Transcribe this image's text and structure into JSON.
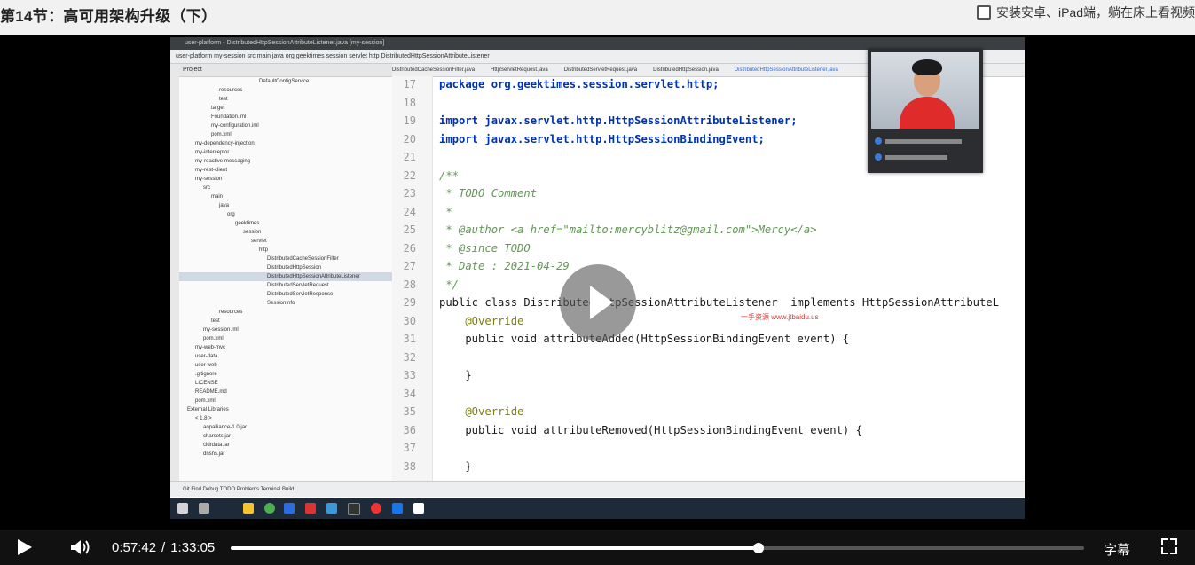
{
  "header": {
    "lesson_title": "第14节：高可用架构升级（下）",
    "install_promo": "安装安卓、iPad端，躺在床上看视频"
  },
  "ide": {
    "window_title": "user-platform - DistributedHttpSessionAttributeListener.java [my-session]",
    "breadcrumb": "user-platform  my-session  src  main  java  org  geektimes  session  servlet  http  DistributedHttpSessionAttributeListener",
    "project_header": "Project",
    "tree": [
      "DefaultConfigService",
      "resources",
      "test",
      "target",
      "Foundation.iml",
      "my-configuration.iml",
      "pom.xml",
      "my-dependency-injection",
      "my-interceptor",
      "my-reactive-messaging",
      "my-rest-client",
      "my-session",
      "src",
      "main",
      "java",
      "org",
      "geektimes",
      "session",
      "servlet",
      "http",
      "DistributedCacheSessionFilter",
      "DistributedHttpSession",
      "DistributedHttpSessionAttributeListener",
      "DistributedServletRequest",
      "DistributedServletResponse",
      "SessionInfo",
      "resources",
      "test",
      "my-session.iml",
      "pom.xml",
      "my-web-mvc",
      "user-data",
      "user-web",
      ".gitignore",
      "LICENSE",
      "README.md",
      "pom.xml",
      "External Libraries",
      "< 1.8 >",
      "aopalliance-1.0.jar",
      "charsets.jar",
      "cldrdata.jar",
      "dnsns.jar"
    ],
    "tabs": [
      "DistributedCacheSessionFilter.java",
      "HttpServletRequest.java",
      "DistributedServletRequest.java",
      "DistributedHttpSession.java",
      "DistributedHttpSessionAttributeListener.java"
    ],
    "line_numbers": [
      "17",
      "18",
      "19",
      "20",
      "21",
      "22",
      "23",
      "24",
      "25",
      "26",
      "27",
      "28",
      "29",
      "30",
      "31",
      "32",
      "33",
      "34",
      "35",
      "36",
      "37",
      "38"
    ],
    "code": [
      "package org.geektimes.session.servlet.http;",
      "",
      "import javax.servlet.http.HttpSessionAttributeListener;",
      "import javax.servlet.http.HttpSessionBindingEvent;",
      "",
      "/**",
      " * TODO Comment",
      " *",
      " * @author <a href=\"mailto:mercyblitz@gmail.com\">Mercy</a>",
      " * @since TODO",
      " * Date : 2021-04-29",
      " */",
      "public class DistributedHttpSessionAttributeListener  implements HttpSessionAttributeL",
      "    @Override",
      "    public void attributeAdded(HttpSessionBindingEvent event) {",
      "",
      "    }",
      "",
      "    @Override",
      "    public void attributeRemoved(HttpSessionBindingEvent event) {",
      "",
      "    }"
    ],
    "bottom_bar": "Git   Find   Debug   TODO   Problems   Terminal   Build"
  },
  "overlay": {
    "watermark": "一手资源 www.jtbaidu.us"
  },
  "player": {
    "current_time": "0:57:42",
    "separator": "/",
    "total_time": "1:33:05",
    "progress": 0.619,
    "subtitles_label": "字幕"
  },
  "colors": {
    "topbar_bg": "#f1f1f1",
    "controls_bg": "#111111",
    "progress_track": "#555555",
    "progress_fill": "#ffffff"
  },
  "icons": [
    "checkbox-icon",
    "play-icon",
    "volume-icon",
    "fullscreen-icon",
    "big-play-icon"
  ]
}
